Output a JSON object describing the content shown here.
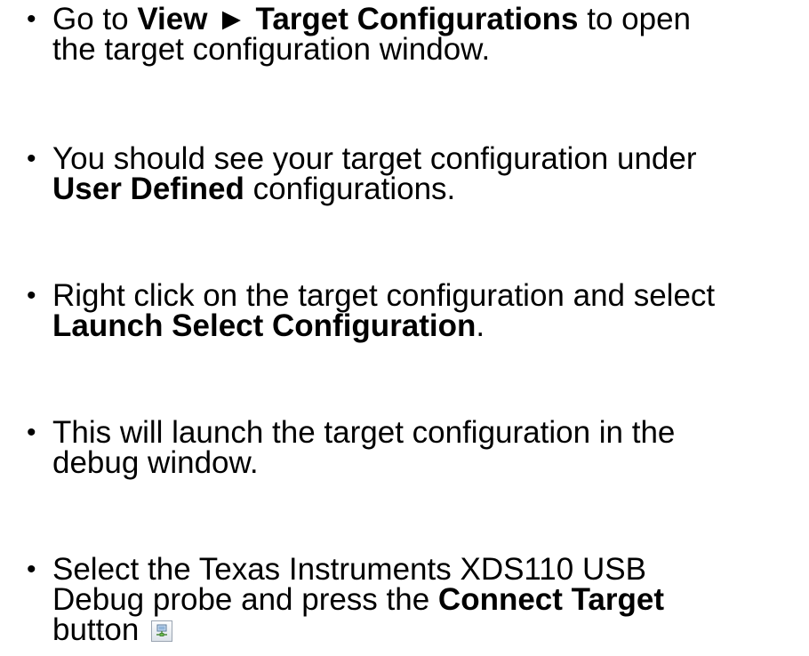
{
  "bullets": [
    {
      "lines": [
        [
          "Go to ",
          "View ► Target Configurations",
          " to open"
        ],
        [
          "the target configuration window."
        ]
      ]
    },
    {
      "lines": [
        [
          "You should see your target configuration under"
        ],
        [
          "User Defined",
          " configurations."
        ]
      ]
    },
    {
      "lines": [
        [
          "Right click on the target configuration and select"
        ],
        [
          "Launch Select Configuration",
          "."
        ]
      ]
    },
    {
      "lines": [
        [
          "This will launch the target configuration in the"
        ],
        [
          "debug window."
        ]
      ]
    },
    {
      "lines": [
        [
          "Select the Texas Instruments XDS110 USB"
        ],
        [
          "Debug probe and press the ",
          "Connect Target"
        ],
        [
          "button "
        ]
      ]
    }
  ],
  "bullet_glyph": "•",
  "icons": {
    "connect_target": "connect-target-icon"
  },
  "colors": {
    "text": "#000000",
    "background": "#ffffff"
  }
}
